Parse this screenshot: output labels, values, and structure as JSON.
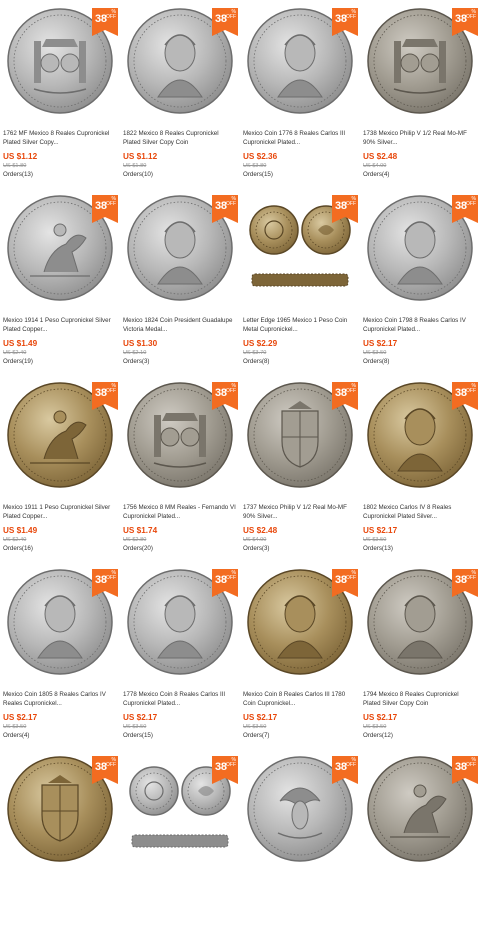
{
  "badge": {
    "percent": "38",
    "sign": "%",
    "off": "OFF"
  },
  "colors": {
    "badge": "#f36c21",
    "price": "#e8470b",
    "silver": "#c9c9c9",
    "bronze": "#8a6a3a"
  },
  "products": [
    {
      "title": "1762 MF Mexico 8 Reales Cupronickel Plated Silver Copy...",
      "price": "US $1.12",
      "orig": "US $1.80",
      "orders": "Orders(13)",
      "icon": "pillars-coin-icon",
      "tone": "silver"
    },
    {
      "title": "1822 Mexico 8 Reales Cupronickel Plated Silver Copy Coin",
      "price": "US $1.12",
      "orig": "US $1.80",
      "orders": "Orders(10)",
      "icon": "portrait-coin-icon",
      "tone": "silver"
    },
    {
      "title": "Mexico Coin 1776 8 Reales Carlos III Cupronickel Plated...",
      "price": "US $2.36",
      "orig": "US $3.80",
      "orders": "Orders(15)",
      "icon": "portrait-coin-icon",
      "tone": "silver"
    },
    {
      "title": "1738 Mexico Philip V 1/2 Real Mo-MF 90% Silver...",
      "price": "US $2.48",
      "orig": "US $4.00",
      "orders": "Orders(4)",
      "icon": "pillars-coin-icon",
      "tone": "gray"
    },
    {
      "title": "Mexico 1914 1 Peso Cupronickel Silver Plated Copper...",
      "price": "US $1.49",
      "orig": "US $2.40",
      "orders": "Orders(19)",
      "icon": "horseman-coin-icon",
      "tone": "silver"
    },
    {
      "title": "Mexico 1824 Coin President Guadalupe Victoria Medal...",
      "price": "US $1.30",
      "orig": "US $2.10",
      "orders": "Orders(3)",
      "icon": "portrait-coin-icon",
      "tone": "silver"
    },
    {
      "title": "Letter Edge 1965 Mexico 1 Peso Coin Metal Cupronickel...",
      "price": "US $2.29",
      "orig": "US $3.70",
      "orders": "Orders(8)",
      "icon": "two-coins-edge-icon",
      "tone": "bronze"
    },
    {
      "title": "Mexico Coin 1798 8 Reales Carlos IV Cupronickel Plated...",
      "price": "US $2.17",
      "orig": "US $3.50",
      "orders": "Orders(8)",
      "icon": "portrait-coin-icon",
      "tone": "silver"
    },
    {
      "title": "Mexico 1911 1 Peso Cupronickel Silver Plated Copper...",
      "price": "US $1.49",
      "orig": "US $2.40",
      "orders": "Orders(16)",
      "icon": "horseman-coin-icon",
      "tone": "bronze"
    },
    {
      "title": "1756 Mexico 8 MM Reales - Fernando VI Cupronickel Plated...",
      "price": "US $1.74",
      "orig": "US $2.80",
      "orders": "Orders(20)",
      "icon": "pillars-coin-icon",
      "tone": "gray"
    },
    {
      "title": "1737 Mexico Philip V 1/2 Real Mo-MF 90% Silver...",
      "price": "US $2.48",
      "orig": "US $4.00",
      "orders": "Orders(3)",
      "icon": "shield-coin-icon",
      "tone": "gray"
    },
    {
      "title": "1802 Mexico Carlos IV 8 Reales Cupronickel Plated Silver...",
      "price": "US $2.17",
      "orig": "US $3.50",
      "orders": "Orders(13)",
      "icon": "portrait-coin-icon",
      "tone": "bronze"
    },
    {
      "title": "Mexico Coin 1805 8 Reales Carlos IV Reales Cupronickel...",
      "price": "US $2.17",
      "orig": "US $3.50",
      "orders": "Orders(4)",
      "icon": "portrait-coin-icon",
      "tone": "silver"
    },
    {
      "title": "1778 Mexico Coin 8 Reales Carlos III Cupronickel Plated...",
      "price": "US $2.17",
      "orig": "US $3.50",
      "orders": "Orders(15)",
      "icon": "portrait-coin-icon",
      "tone": "silver"
    },
    {
      "title": "Mexico Coin 8 Reales Carlos III 1780 Coin Cupronickel...",
      "price": "US $2.17",
      "orig": "US $3.50",
      "orders": "Orders(7)",
      "icon": "portrait-coin-icon",
      "tone": "bronze"
    },
    {
      "title": "1794 Mexico 8 Reales Cupronickel Plated Silver Copy Coin",
      "price": "US $2.17",
      "orig": "US $3.50",
      "orders": "Orders(12)",
      "icon": "portrait-coin-icon",
      "tone": "gray"
    },
    {
      "title": "",
      "price": "",
      "orig": "",
      "orders": "",
      "icon": "shield-coin-icon",
      "tone": "bronze"
    },
    {
      "title": "",
      "price": "",
      "orig": "",
      "orders": "",
      "icon": "two-coins-edge-icon",
      "tone": "silver"
    },
    {
      "title": "",
      "price": "",
      "orig": "",
      "orders": "",
      "icon": "eagle-coin-icon",
      "tone": "silver"
    },
    {
      "title": "",
      "price": "",
      "orig": "",
      "orders": "",
      "icon": "horseman-coin-icon",
      "tone": "gray"
    }
  ]
}
